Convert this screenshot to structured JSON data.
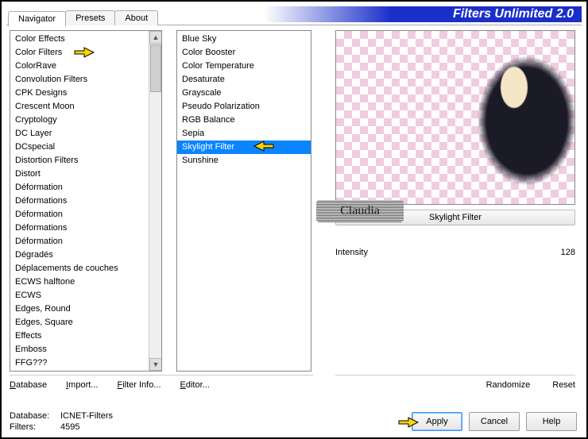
{
  "app": {
    "title": "Filters Unlimited 2.0"
  },
  "tabs": [
    {
      "label": "Navigator",
      "active": true
    },
    {
      "label": "Presets",
      "active": false
    },
    {
      "label": "About",
      "active": false
    }
  ],
  "categories": [
    "Color Effects",
    "Color Filters",
    "ColorRave",
    "Convolution Filters",
    "CPK Designs",
    "Crescent Moon",
    "Cryptology",
    "DC Layer",
    "DCspecial",
    "Distortion Filters",
    "Distort",
    "Déformation",
    "Déformations",
    "Déformation",
    "Déformations",
    "Déformation",
    "Dégradés",
    "Déplacements de couches",
    "ECWS halftone",
    "ECWS",
    "Edges, Round",
    "Edges, Square",
    "Effects",
    "Emboss",
    "FFG???"
  ],
  "selected_category": "Color Filters",
  "filters": [
    "Blue Sky",
    "Color Booster",
    "Color Temperature",
    "Desaturate",
    "Grayscale",
    "Pseudo Polarization",
    "RGB Balance",
    "Sepia",
    "Skylight Filter",
    "Sunshine"
  ],
  "selected_filter": "Skylight Filter",
  "filter_display_name": "Skylight Filter",
  "params": [
    {
      "name": "Intensity",
      "value": 128
    }
  ],
  "toolbar": {
    "database": "Database",
    "import": "Import...",
    "filter_info": "Filter Info...",
    "editor": "Editor...",
    "randomize": "Randomize",
    "reset": "Reset"
  },
  "buttons": {
    "apply": "Apply",
    "cancel": "Cancel",
    "help": "Help"
  },
  "status": {
    "database_label": "Database:",
    "database_value": "ICNET-Filters",
    "filters_label": "Filters:",
    "filters_value": "4595"
  },
  "watermark": "Claudia"
}
